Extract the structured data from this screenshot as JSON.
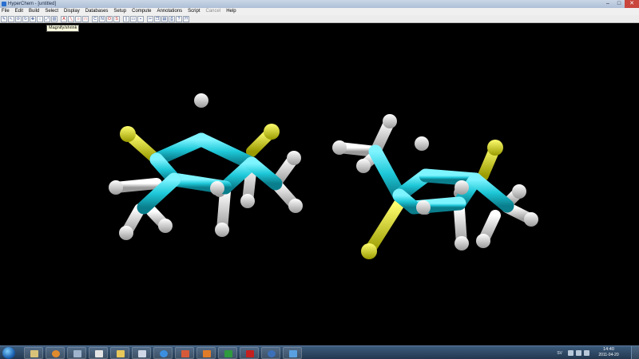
{
  "window": {
    "title": "HyperChem - [untitled]",
    "controls": [
      "minimize",
      "maximize",
      "close"
    ]
  },
  "menu": [
    {
      "label": "File",
      "enabled": true
    },
    {
      "label": "Edit",
      "enabled": true
    },
    {
      "label": "Build",
      "enabled": true
    },
    {
      "label": "Select",
      "enabled": true
    },
    {
      "label": "Display",
      "enabled": true
    },
    {
      "label": "Databases",
      "enabled": true
    },
    {
      "label": "Setup",
      "enabled": true
    },
    {
      "label": "Compute",
      "enabled": true
    },
    {
      "label": "Annotations",
      "enabled": true
    },
    {
      "label": "Script",
      "enabled": true
    },
    {
      "label": "Cancel",
      "enabled": false
    },
    {
      "label": "Help",
      "enabled": true
    }
  ],
  "toolbar": {
    "tools": [
      "draw-icon",
      "select-icon",
      "rotate-xy-icon",
      "rotate-z-icon",
      "translate-xy-icon",
      "translate-z-icon",
      "zoom-icon",
      "clip-icon",
      "annotate-icon",
      "line-icon",
      "circle-icon",
      "rectangle-icon",
      "element-c-icon",
      "element-n-icon",
      "element-o-icon",
      "element-s-icon",
      "new-icon",
      "open-icon",
      "save-icon",
      "cut-icon",
      "copy-icon",
      "paste-icon",
      "print-icon",
      "help-icon",
      "context-help-icon"
    ],
    "tooltip": "Magnify/shrink"
  },
  "colors": {
    "carbon": "#1ec8d8",
    "hydrogen": "#e6e6e6",
    "halogen": "#e0e020",
    "background": "#000000"
  },
  "taskbar": {
    "pinned": [
      "explorer-icon",
      "media-player-icon",
      "network-icon",
      "document-icon",
      "folder-icon",
      "text-editor-icon",
      "ie-icon",
      "paint-icon",
      "office-icon",
      "excel-icon",
      "acrobat-icon",
      "media-center-icon",
      "hyperchem-icon"
    ],
    "language": "SV",
    "time": "14:40",
    "date": "2011-04-20"
  }
}
